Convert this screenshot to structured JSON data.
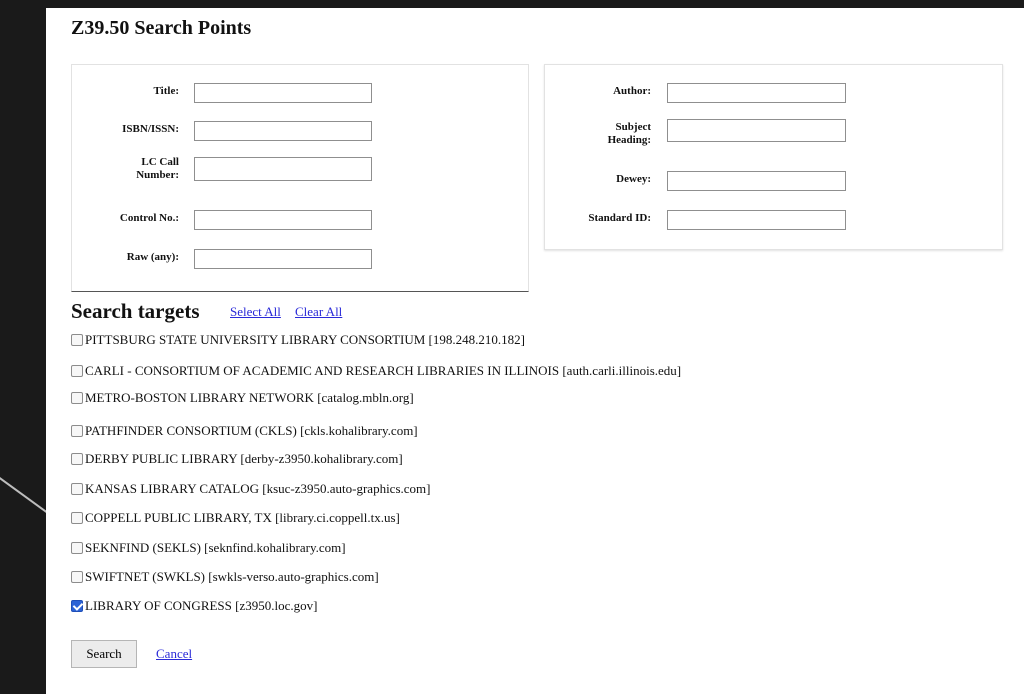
{
  "page_title": "Z39.50 Search Points",
  "left_fields": [
    {
      "label": "Title:",
      "value": ""
    },
    {
      "label": "ISBN/ISSN:",
      "value": ""
    },
    {
      "label": "LC Call\nNumber:",
      "value": ""
    },
    {
      "label": "Control No.:",
      "value": ""
    },
    {
      "label": "Raw (any):",
      "value": ""
    }
  ],
  "right_fields": [
    {
      "label": "Author:",
      "value": ""
    },
    {
      "label": "Subject\nHeading:",
      "value": ""
    },
    {
      "label": "Dewey:",
      "value": ""
    },
    {
      "label": "Standard ID:",
      "value": ""
    }
  ],
  "targets_heading": "Search targets",
  "select_all_label": "Select All",
  "clear_all_label": "Clear All",
  "targets": [
    {
      "label": "PITTSBURG STATE UNIVERSITY LIBRARY CONSORTIUM [198.248.210.182]",
      "checked": false
    },
    {
      "label": "CARLI - CONSORTIUM OF ACADEMIC AND RESEARCH LIBRARIES IN ILLINOIS [auth.carli.illinois.edu]",
      "checked": false
    },
    {
      "label": "METRO-BOSTON LIBRARY NETWORK [catalog.mbln.org]",
      "checked": false
    },
    {
      "label": "PATHFINDER CONSORTIUM (CKLS) [ckls.kohalibrary.com]",
      "checked": false
    },
    {
      "label": "DERBY PUBLIC LIBRARY [derby-z3950.kohalibrary.com]",
      "checked": false
    },
    {
      "label": "KANSAS LIBRARY CATALOG [ksuc-z3950.auto-graphics.com]",
      "checked": false
    },
    {
      "label": "COPPELL PUBLIC LIBRARY, TX [library.ci.coppell.tx.us]",
      "checked": false
    },
    {
      "label": "SEKNFIND (SEKLS) [seknfind.kohalibrary.com]",
      "checked": false
    },
    {
      "label": "SWIFTNET (SWKLS) [swkls-verso.auto-graphics.com]",
      "checked": false
    },
    {
      "label": "LIBRARY OF CONGRESS [z3950.loc.gov]",
      "checked": true
    }
  ],
  "search_button_label": "Search",
  "cancel_label": "Cancel"
}
